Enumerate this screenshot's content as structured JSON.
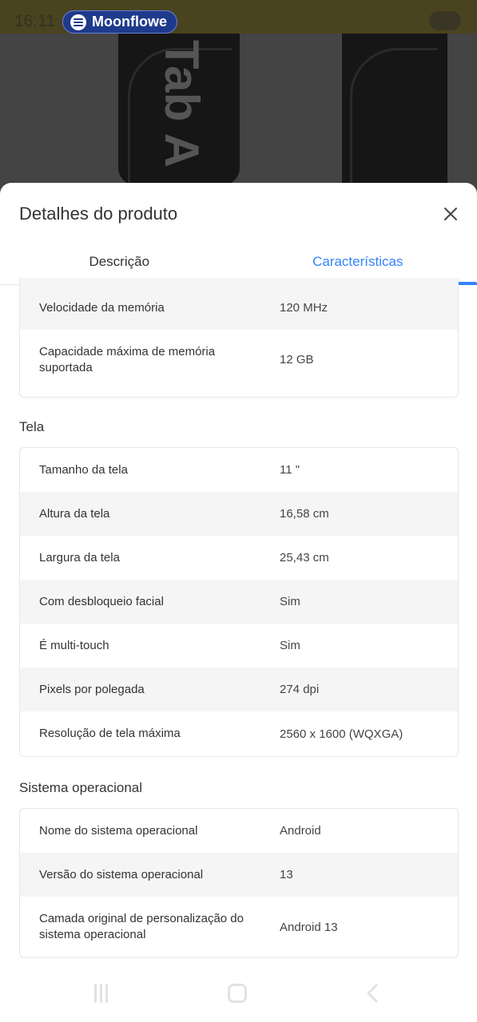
{
  "status_bar": {
    "time": "16:11",
    "now_playing_app": "Moonflowe"
  },
  "backdrop": {
    "brand_text": "Tab A"
  },
  "sheet": {
    "title": "Detalhes do produto",
    "close_icon": "close-icon"
  },
  "tabs": [
    {
      "label": "Descrição",
      "active": false
    },
    {
      "label": "Características",
      "active": true
    }
  ],
  "memory_rows": [
    {
      "label": "Velocidade da memória",
      "value": "120 MHz"
    },
    {
      "label": "Capacidade máxima de memória suportada",
      "value": "12 GB"
    }
  ],
  "screen": {
    "title": "Tela",
    "rows": [
      {
        "label": "Tamanho da tela",
        "value": "11 \""
      },
      {
        "label": "Altura da tela",
        "value": "16,58 cm"
      },
      {
        "label": "Largura da tela",
        "value": "25,43 cm"
      },
      {
        "label": "Com desbloqueio facial",
        "value": "Sim"
      },
      {
        "label": "É multi-touch",
        "value": "Sim"
      },
      {
        "label": "Pixels por polegada",
        "value": "274 dpi"
      },
      {
        "label": "Resolução de tela máxima",
        "value": "2560 x 1600 (WQXGA)"
      }
    ]
  },
  "os": {
    "title": "Sistema operacional",
    "rows": [
      {
        "label": "Nome do sistema operacional",
        "value": "Android"
      },
      {
        "label": "Versão do sistema operacional",
        "value": "13"
      },
      {
        "label": "Camada original de personalização do sistema operacional",
        "value": "Android 13"
      }
    ]
  },
  "colors": {
    "accent": "#3483fa",
    "row_shade": "#f5f5f5",
    "text": "#333333"
  }
}
